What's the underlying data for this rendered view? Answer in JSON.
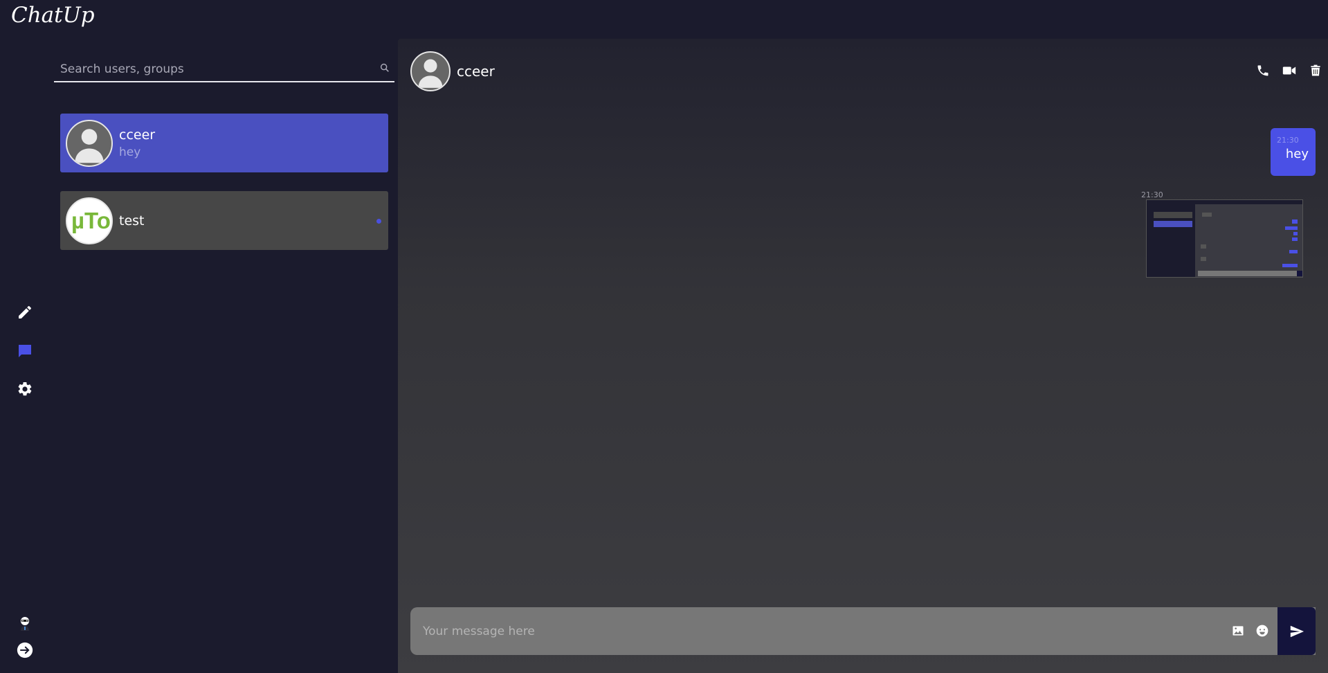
{
  "app": {
    "title": "ChatUp"
  },
  "search": {
    "placeholder": "Search users, groups"
  },
  "rail": {
    "icons": [
      "pencil-icon",
      "chat-bubble-icon",
      "gear-icon",
      "user-avatar-icon",
      "logout-icon"
    ],
    "active": "chat-bubble-icon",
    "accent": "#4a50e6"
  },
  "conversations": [
    {
      "name": "cceer",
      "preview": "hey",
      "active": true,
      "avatar": "default-user-avatar"
    },
    {
      "name": "test",
      "preview": "",
      "active": false,
      "avatar": "utorrent-logo",
      "avatar_text": "µTor"
    }
  ],
  "chat": {
    "contact_name": "cceer",
    "actions": [
      "phone-icon",
      "video-icon",
      "trash-icon"
    ],
    "messages": [
      {
        "type": "text",
        "time": "21:30",
        "text": "hey",
        "from": "me"
      },
      {
        "type": "image",
        "time": "21:30",
        "from": "me"
      }
    ],
    "composer": {
      "placeholder": "Your message here",
      "icons": [
        "image-attach-icon",
        "emoji-icon",
        "send-icon"
      ]
    }
  },
  "colors": {
    "background": "#1b1b2d",
    "active_conversation": "#4a50c0",
    "inactive_conversation": "#474747",
    "bubble": "#4a50e6",
    "send_button": "#14143c"
  }
}
